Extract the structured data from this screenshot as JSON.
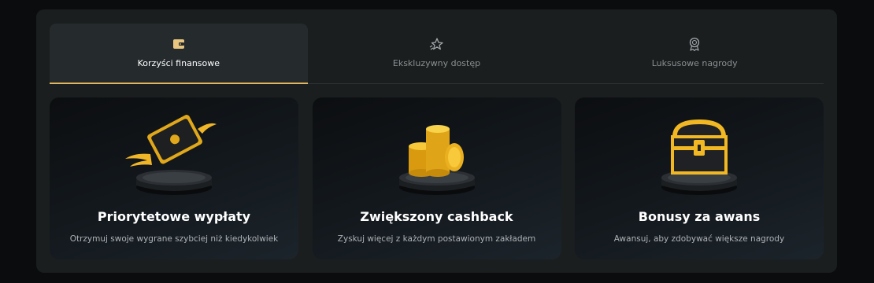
{
  "tabs": [
    {
      "label": "Korzyści finansowe",
      "icon": "wallet-icon",
      "active": true
    },
    {
      "label": "Ekskluzywny dostęp",
      "icon": "star-icon",
      "active": false
    },
    {
      "label": "Luksusowe nagrody",
      "icon": "award-icon",
      "active": false
    }
  ],
  "cards": [
    {
      "title": "Priorytetowe wypłaty",
      "description": "Otrzymuj swoje wygrane szybciej niż kiedykolwiek",
      "icon": "winged-banknote-icon"
    },
    {
      "title": "Zwiększony cashback",
      "description": "Zyskuj więcej z każdym postawionym zakładem",
      "icon": "coin-stack-icon"
    },
    {
      "title": "Bonusy za awans",
      "description": "Awansuj, aby zdobywać większe nagrody",
      "icon": "treasure-chest-icon"
    }
  ],
  "colors": {
    "accent": "#e3b560",
    "gold": "#f2b824",
    "panel": "#1a1e1f"
  }
}
